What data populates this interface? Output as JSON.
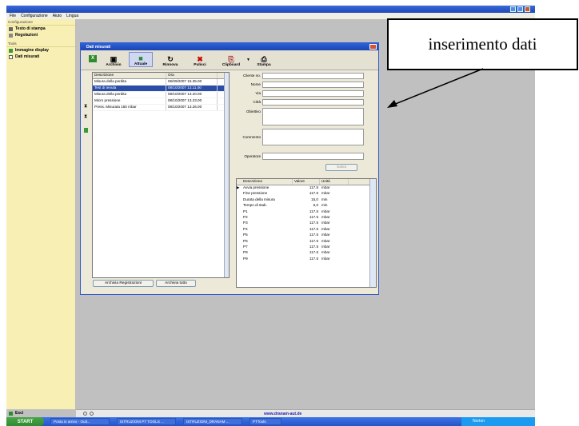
{
  "menubar": {
    "items": [
      "File",
      "Configurazione",
      "Aiuto",
      "Lingua"
    ]
  },
  "sidebar": {
    "groups": [
      {
        "label": "Configurazione",
        "items": [
          {
            "label": "Testo di stampa",
            "icon": "printer-icon"
          },
          {
            "label": "Regolazioni",
            "icon": "wrench-icon"
          }
        ]
      },
      {
        "label": "Tools",
        "items": [
          {
            "label": "Immagine display",
            "icon": "monitor-icon"
          },
          {
            "label": "Dati misurati",
            "icon": "table-icon"
          }
        ]
      }
    ],
    "exit_label": "Esci"
  },
  "dialog": {
    "title": "Dati misurati",
    "toolbar": {
      "buttons": [
        {
          "label": "Archivio",
          "glyph": "▣"
        },
        {
          "label": "Attuale",
          "glyph": "■",
          "active": true
        },
        {
          "label": "Rinnova",
          "glyph": "↻"
        },
        {
          "label": "Pulisci",
          "glyph": "✖"
        },
        {
          "label": "Clipboard",
          "glyph": "⎘"
        },
        {
          "label": "Stampa",
          "glyph": "⎙"
        }
      ]
    },
    "list": {
      "columns": [
        "Descrizione",
        "Ora"
      ],
      "rows": [
        {
          "desc": "Misura della perdita",
          "time": "06/09/2007 15.35.00",
          "selected": false
        },
        {
          "desc": "Test di tenuta",
          "time": "08/10/2007 13.11.00",
          "selected": true
        },
        {
          "desc": "Misura della perdita",
          "time": "08/10/2007 13.20.00",
          "selected": false
        },
        {
          "desc": "Micro pressione",
          "time": "08/10/2007 13.23.00",
          "selected": false
        },
        {
          "desc": "Press. Misurata 150 mbar",
          "time": "08/10/2007 13.26.00",
          "selected": false
        }
      ]
    },
    "form": {
      "fields": [
        {
          "label": "Cliente no.",
          "value": ""
        },
        {
          "label": "Nome",
          "value": ""
        },
        {
          "label": "Via",
          "value": ""
        },
        {
          "label": "Città",
          "value": ""
        },
        {
          "label": "Obiettivo",
          "value": ""
        },
        {
          "label": "Commento",
          "value": ""
        },
        {
          "label": "Operatore",
          "value": ""
        }
      ],
      "save_label": "Salva"
    },
    "values_table": {
      "columns": [
        "Descrizione",
        "Valore",
        "Unità"
      ],
      "rows": [
        [
          "Avvia pressione",
          "117.5",
          "mbar"
        ],
        [
          "Fine pressione",
          "117.6",
          "mbar"
        ],
        [
          "Durata della misura",
          "15,0",
          "min"
        ],
        [
          "Tempo di stab.",
          "6,0",
          "min"
        ],
        [
          "P1",
          "117.5",
          "mbar"
        ],
        [
          "P2",
          "117.5",
          "mbar"
        ],
        [
          "P3",
          "117.5",
          "mbar"
        ],
        [
          "P4",
          "117.5",
          "mbar"
        ],
        [
          "P5",
          "117.5",
          "mbar"
        ],
        [
          "P6",
          "117.5",
          "mbar"
        ],
        [
          "P7",
          "117.5",
          "mbar"
        ],
        [
          "P8",
          "117.5",
          "mbar"
        ],
        [
          "P9",
          "117.5",
          "mbar"
        ]
      ]
    },
    "buttons": {
      "archive_records": "Archivia Registrazioni",
      "archive_all": "Archivia tutto"
    }
  },
  "statusbar": {
    "url": "www.dranam-aut.de"
  },
  "taskbar": {
    "start_label": "START",
    "tasks": [
      "Posta in arrivo - Outl...",
      "ISTRUZIONI PT TOOLS ...",
      "ISTRUZIONI_DRANAM ...",
      "PTTools"
    ],
    "tray_label": "Norton"
  },
  "callout": {
    "text": "inserimento dati"
  }
}
